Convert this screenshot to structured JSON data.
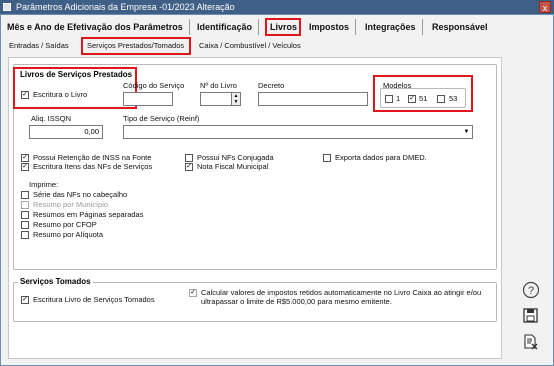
{
  "window": {
    "title": "Parâmetros Adicionais da Empresa -01/2023 Alteração",
    "close": "x"
  },
  "main_tabs": [
    {
      "label": "Mês e Ano de Efetivação dos Parâmetros"
    },
    {
      "label": "Identificação"
    },
    {
      "label": "Livros",
      "active": true
    },
    {
      "label": "Impostos"
    },
    {
      "label": "Integrações"
    },
    {
      "label": "Responsável"
    }
  ],
  "sub_tabs": [
    {
      "label": "Entradas / Saídas"
    },
    {
      "label": "Serviços Prestados/Tomados",
      "active": true
    },
    {
      "label": "Caixa / Combustível / Veículos"
    }
  ],
  "livros_prestados": {
    "title": "Livros de Serviços Prestados",
    "escritura_label": "Escritura o Livro",
    "escritura_checked": "✓",
    "codigo_servico_label": "Código do Serviço",
    "codigo_servico_value": "",
    "nr_livro_label": "Nº do Livro",
    "nr_livro_value": "",
    "decreto_label": "Decreto",
    "decreto_value": "",
    "modelos_label": "Modelos",
    "modelos": [
      {
        "label": "1",
        "checked": ""
      },
      {
        "label": "51",
        "checked": "✓"
      },
      {
        "label": "53",
        "checked": ""
      }
    ],
    "aliq_label": "Aliq. ISSQN",
    "aliq_value": "0,00",
    "tipo_servico_label": "Tipo de Serviço (Reinf)",
    "tipo_servico_value": ""
  },
  "options_col1": [
    {
      "label": "Possui Retenção de INSS na Fonte",
      "checked": "✓"
    },
    {
      "label": "Escritura Itens das NFs de Serviços",
      "checked": "✓"
    }
  ],
  "options_col2": [
    {
      "label": "Possui NFs Conjugada",
      "checked": ""
    },
    {
      "label": "Nota Fiscal Municipal",
      "checked": "✓"
    }
  ],
  "options_col3": [
    {
      "label": "Exporta dados para DMED.",
      "checked": ""
    }
  ],
  "imprime": {
    "label": "Imprime:",
    "items": [
      {
        "label": "Série das NFs no cabeçalho",
        "checked": "",
        "disabled": false
      },
      {
        "label": "Resumo por Município",
        "checked": "",
        "disabled": true
      },
      {
        "label": "Resumos em Páginas separadas",
        "checked": "",
        "disabled": false
      },
      {
        "label": "Resumo por CFOP",
        "checked": "",
        "disabled": false
      },
      {
        "label": "Resumo por Alíquota",
        "checked": "",
        "disabled": false
      }
    ]
  },
  "servicos_tomados": {
    "title": "Serviços Tomados",
    "escritura_label": "Escritura Livro de Serviços Tomados",
    "escritura_checked": "✓",
    "calcular_line1": "Calcular valores de impostos retidos automaticamente no Livro Caixa ao atingir e/ou",
    "calcular_line2": "ultrapassar o limite de R$5.000,00 para mesmo emitente.",
    "calcular_checked": "✓"
  },
  "side_icons": [
    {
      "name": "help-icon",
      "glyph": "?"
    },
    {
      "name": "save-icon",
      "glyph": ""
    },
    {
      "name": "cancel-document-icon",
      "glyph": ""
    }
  ]
}
